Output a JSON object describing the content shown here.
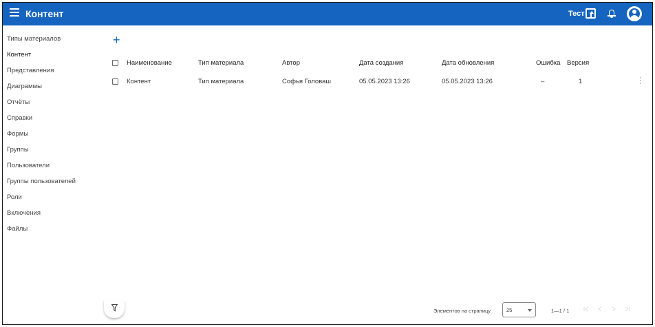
{
  "header": {
    "title": "Контент",
    "user_name": "Тест",
    "colors": {
      "bar": "#1565c0",
      "text": "#ffffff"
    }
  },
  "sidebar": {
    "items": [
      {
        "label": "Типы материалов"
      },
      {
        "label": "Контент",
        "active": true
      },
      {
        "label": "Представления"
      },
      {
        "label": "Диаграммы"
      },
      {
        "label": "Отчёты"
      },
      {
        "label": "Справки"
      },
      {
        "label": "Формы"
      },
      {
        "label": "Группы"
      },
      {
        "label": "Пользователи"
      },
      {
        "label": "Группы пользователей"
      },
      {
        "label": "Роли"
      },
      {
        "label": "Включения"
      },
      {
        "label": "Файлы"
      }
    ]
  },
  "toolbar": {
    "add_icon": "plus-icon"
  },
  "table": {
    "columns": [
      "Наименование",
      "Тип материала",
      "Автор",
      "Дата создания",
      "Дата обновления",
      "Ошибка",
      "Версия"
    ],
    "rows": [
      [
        "Контент",
        "Тип материала",
        "Софья Головаш",
        "05.05.2023 13:26",
        "05.05.2023 13:26",
        "–",
        "1"
      ]
    ]
  },
  "footer": {
    "filter_icon": "filter-icon",
    "page_size_label": "Элементов на страницу",
    "page_size": "25",
    "range": "1—1 / 1"
  }
}
